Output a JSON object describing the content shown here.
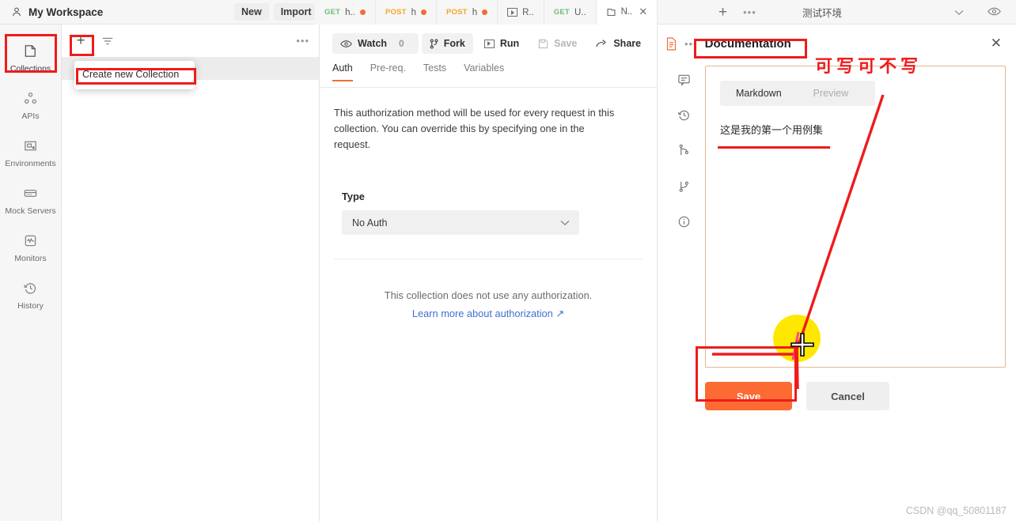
{
  "topbar": {
    "workspace_icon": "user-icon",
    "workspace_title": "My Workspace",
    "new_label": "New",
    "import_label": "Import",
    "add_tab_icon": "plus-icon",
    "more_tabs_icon": "ellipsis-icon",
    "environment_value": "测试环境",
    "environment_caret_icon": "chevron-down-icon",
    "eye_icon": "eye-icon"
  },
  "tabs": [
    {
      "method": "GET",
      "name": "h..",
      "unsaved": true,
      "method_class": "m-get",
      "icon": ""
    },
    {
      "method": "POST",
      "name": "h",
      "unsaved": true,
      "method_class": "m-post",
      "icon": ""
    },
    {
      "method": "POST",
      "name": "h",
      "unsaved": true,
      "method_class": "m-post",
      "icon": ""
    },
    {
      "method": "",
      "name": "R..",
      "unsaved": false,
      "method_class": "",
      "icon": "runner-icon"
    },
    {
      "method": "GET",
      "name": "U..",
      "unsaved": false,
      "method_class": "m-get",
      "icon": ""
    },
    {
      "method": "",
      "name": "N..",
      "unsaved": false,
      "method_class": "",
      "icon": "collection-icon",
      "active": true,
      "close_glyph": "✕"
    }
  ],
  "rail": {
    "items": [
      {
        "label": "Collections",
        "icon": "collection-icon",
        "active": true
      },
      {
        "label": "APIs",
        "icon": "apis-icon",
        "active": false
      },
      {
        "label": "Environments",
        "icon": "environment-icon",
        "active": false
      },
      {
        "label": "Mock Servers",
        "icon": "mock-server-icon",
        "active": false
      },
      {
        "label": "Monitors",
        "icon": "monitor-icon",
        "active": false
      },
      {
        "label": "History",
        "icon": "history-icon",
        "active": false
      }
    ]
  },
  "collections_panel": {
    "add_icon": "plus-icon",
    "filter_icon": "filter-icon",
    "more_icon": "ellipsis-icon",
    "menu": {
      "create_collection_label": "Create new Collection"
    }
  },
  "middle": {
    "toolbar": {
      "watch_label": "Watch",
      "watch_icon": "eye-icon",
      "watch_count": "0",
      "fork_label": "Fork",
      "fork_icon": "fork-icon",
      "run_label": "Run",
      "run_icon": "play-icon",
      "save_label": "Save",
      "save_icon": "floppy-icon",
      "share_label": "Share",
      "share_icon": "share-icon",
      "doc_icon": "document-icon",
      "doc_more_icon": "ellipsis-icon"
    },
    "tabs": [
      {
        "label": "Auth",
        "active": true
      },
      {
        "label": "Pre-req.",
        "active": false
      },
      {
        "label": "Tests",
        "active": false
      },
      {
        "label": "Variables",
        "active": false
      }
    ],
    "auth_description": "This authorization method will be used for every request in this collection. You can override this by specifying one in the request.",
    "type_label": "Type",
    "type_value": "No Auth",
    "type_caret_icon": "chevron-down-icon",
    "no_auth_text": "This collection does not use any authorization.",
    "learn_more_label": "Learn more about authorization",
    "learn_more_glyph": "↗"
  },
  "documentation": {
    "title": "Documentation",
    "close_icon": "close-icon",
    "rail_icons": [
      "comment-icon",
      "history-icon",
      "pull-request-icon",
      "branch-icon",
      "info-icon"
    ],
    "editor": {
      "markdown_tab": "Markdown",
      "preview_tab": "Preview",
      "content": "这是我的第一个用例集"
    },
    "save_label": "Save",
    "cancel_label": "Cancel"
  },
  "annotations": {
    "chinese_note": "可写可不写",
    "red_color": "#ef1b1b",
    "highlight_color": "#ffe800",
    "accent_color": "#fb6b33"
  },
  "watermark": "CSDN @qq_50801187"
}
